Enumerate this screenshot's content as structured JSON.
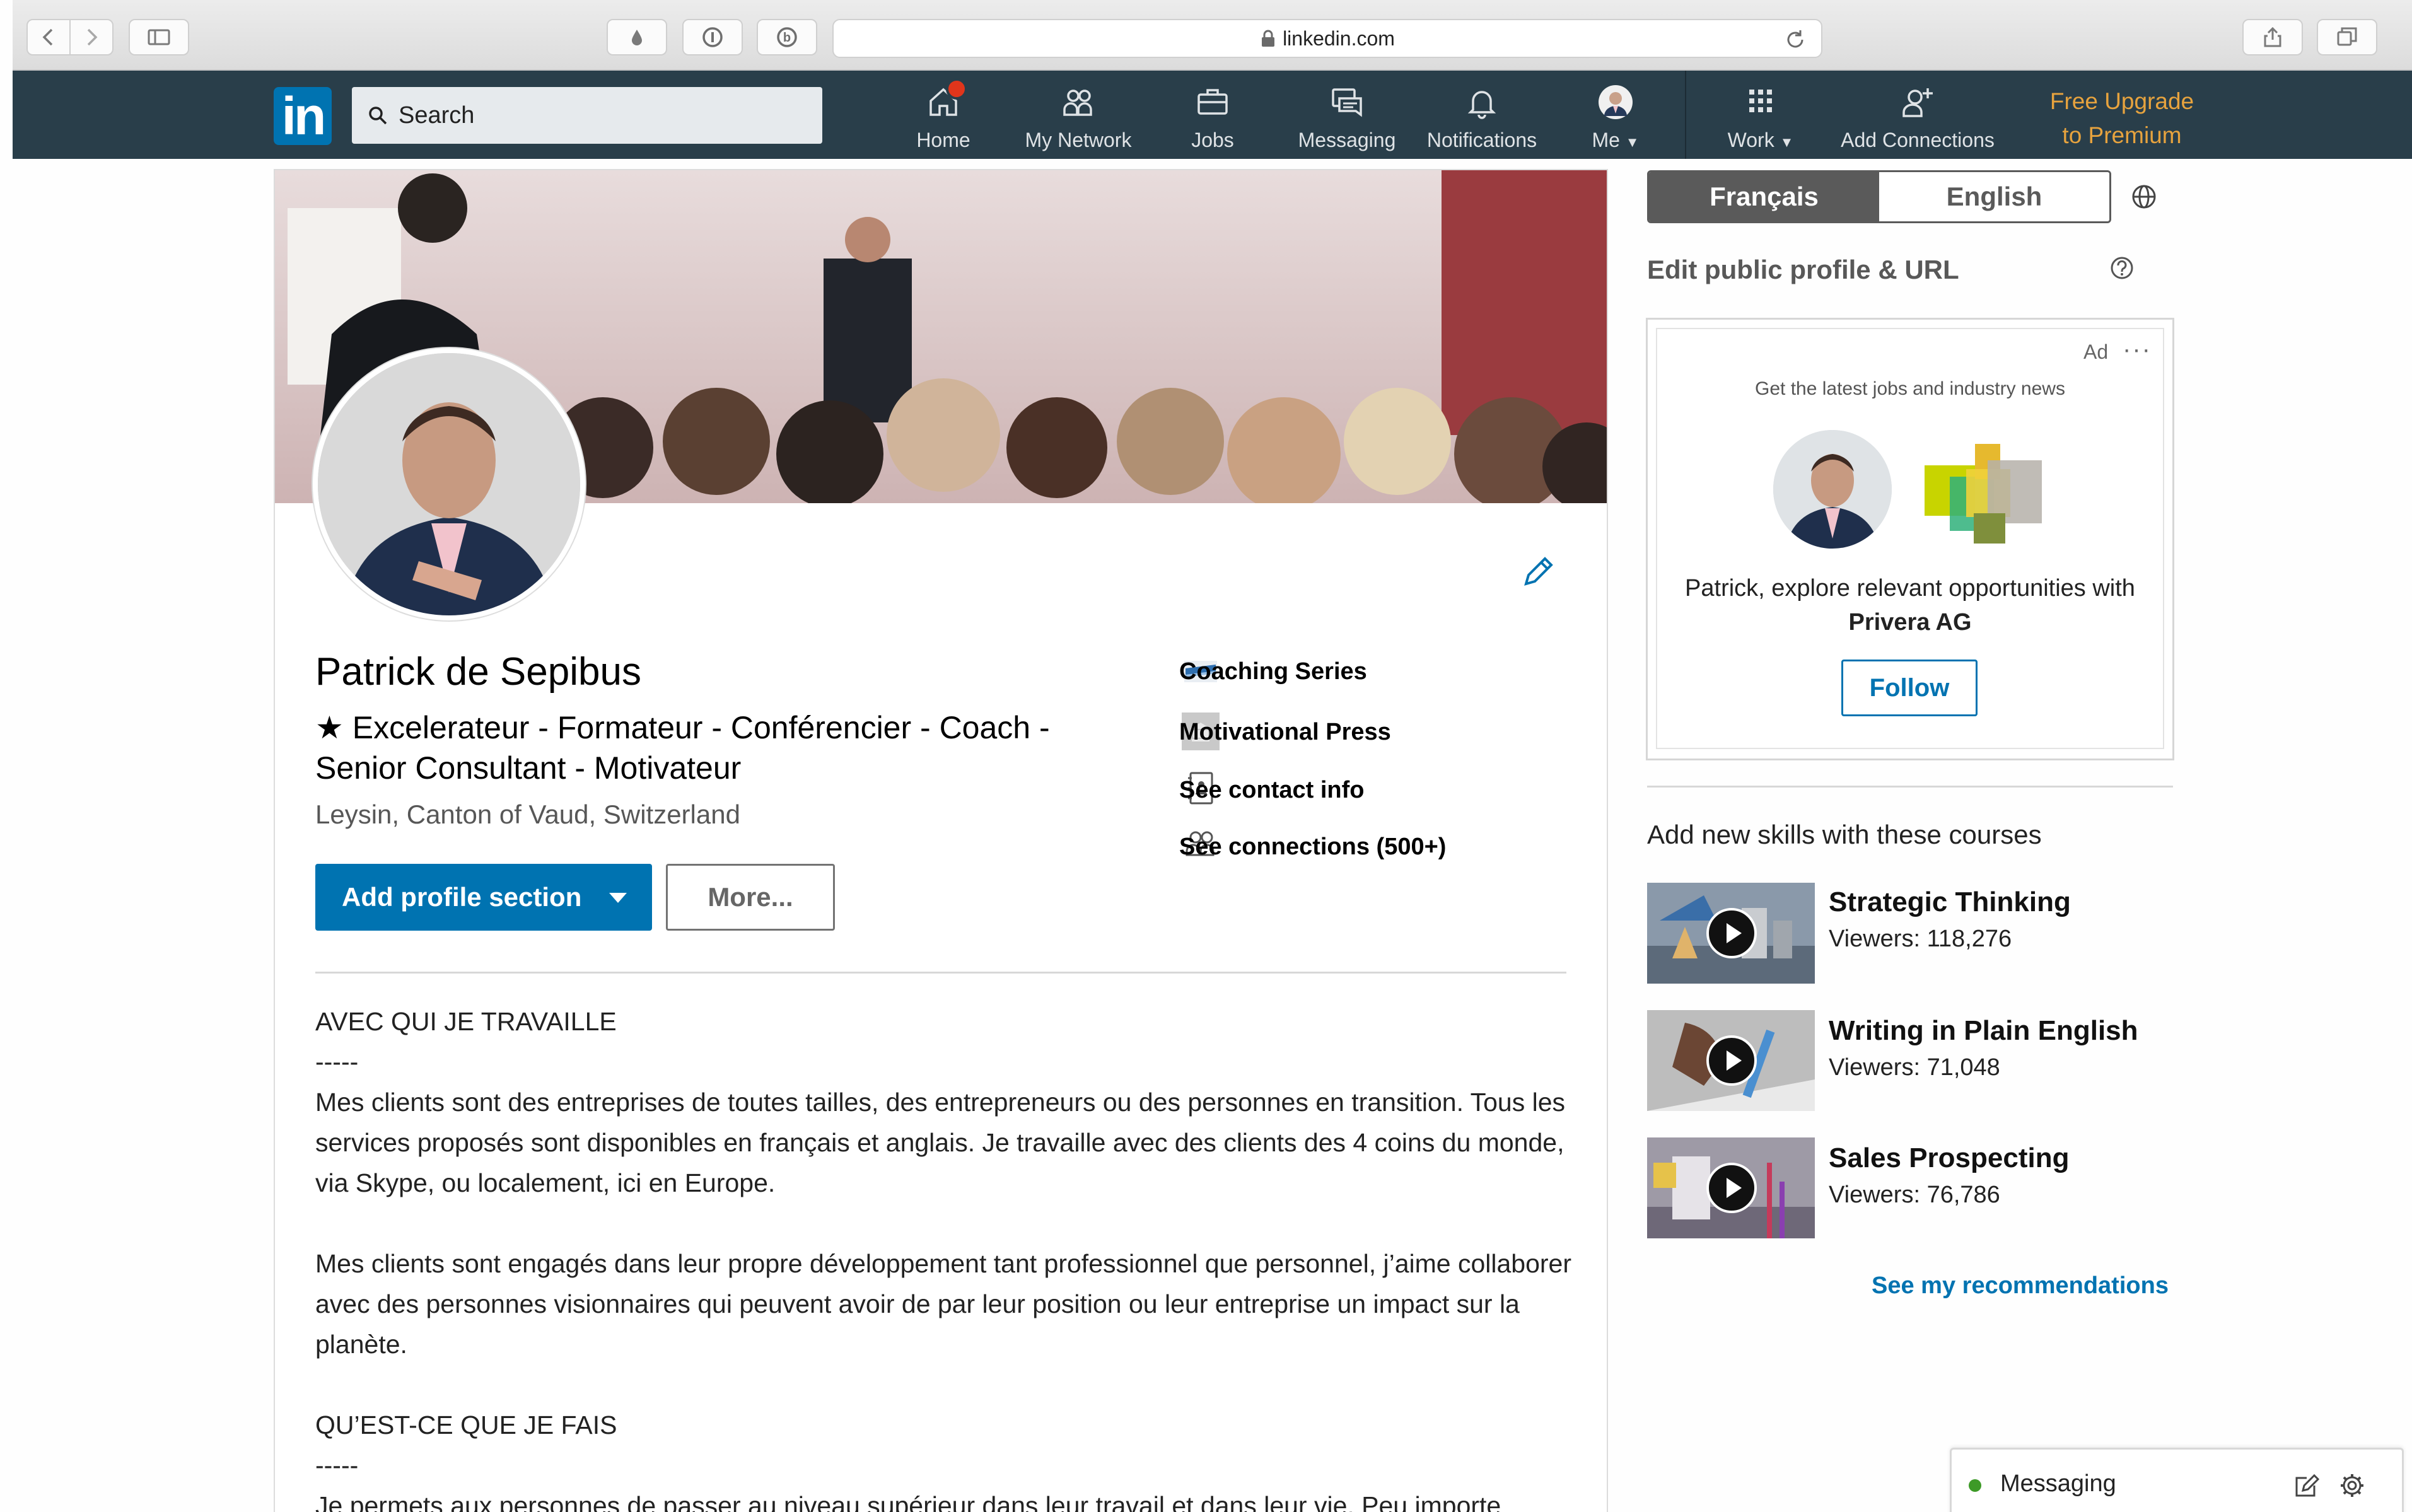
{
  "browser": {
    "url": "linkedin.com"
  },
  "nav": {
    "search_placeholder": "Search",
    "items": [
      {
        "label": "Home",
        "icon": "home-icon"
      },
      {
        "label": "My Network",
        "icon": "network-icon"
      },
      {
        "label": "Jobs",
        "icon": "briefcase-icon"
      },
      {
        "label": "Messaging",
        "icon": "messaging-icon"
      },
      {
        "label": "Notifications",
        "icon": "bell-icon"
      },
      {
        "label": "Me",
        "icon": "avatar"
      },
      {
        "label": "Work",
        "icon": "grid-icon"
      },
      {
        "label": "Add Connections",
        "icon": "add-person-icon"
      }
    ],
    "premium_line1": "Free Upgrade",
    "premium_line2": "to Premium",
    "brand_color": "#0073b1",
    "nav_color": "#293e4a",
    "premium_color": "#e7a33e"
  },
  "profile": {
    "name": "Patrick de Sepibus",
    "headline": "★ Excelerateur - Formateur - Conférencier - Coach - Senior Consultant - Motivateur",
    "location": "Leysin, Canton of Vaud, Switzerland",
    "add_section_label": "Add profile section",
    "more_label": "More...",
    "side_links": [
      {
        "label": "Coaching Series",
        "icon": "company-logo-icon"
      },
      {
        "label": "Motivational Press",
        "icon": "school-icon"
      },
      {
        "label": "See contact info",
        "icon": "contact-card-icon"
      },
      {
        "label": "See connections (500+)",
        "icon": "connections-icon"
      }
    ],
    "summary": {
      "heading1": "AVEC QUI JE TRAVAILLE",
      "sep1": "-----",
      "para1": "Mes clients sont des entreprises de toutes tailles, des entrepreneurs ou des personnes en transition. Tous les services proposés sont disponibles en français et anglais. Je travaille avec des clients des 4 coins du monde, via Skype, ou localement, ici en Europe.",
      "para2": "Mes clients sont engagés dans leur propre développement tant professionnel que personnel, j’aime collaborer avec des personnes visionnaires qui peuvent avoir de par leur position ou leur entreprise un impact sur la planète.",
      "heading2": "QU’EST-CE QUE JE FAIS",
      "sep2": "-----",
      "para3": "Je permets aux personnes de passer au niveau supérieur dans leur travail et dans leur vie. Peu importe"
    }
  },
  "rail": {
    "lang_fr": "Français",
    "lang_en": "English",
    "edit_public": "Edit public profile & URL",
    "ad": {
      "label": "Ad",
      "dots": "···",
      "tagline": "Get the latest jobs and industry news",
      "text_prefix": "Patrick, explore relevant opportunities with",
      "company": "Privera AG",
      "follow_label": "Follow"
    },
    "courses_title": "Add new skills with these courses",
    "courses": [
      {
        "title": "Strategic Thinking",
        "viewers": "Viewers: 118,276"
      },
      {
        "title": "Writing in Plain English",
        "viewers": "Viewers: 71,048"
      },
      {
        "title": "Sales Prospecting",
        "viewers": "Viewers: 76,786"
      }
    ],
    "see_recommendations": "See my recommendations"
  },
  "messaging": {
    "label": "Messaging",
    "status_color": "#3d9a27"
  }
}
